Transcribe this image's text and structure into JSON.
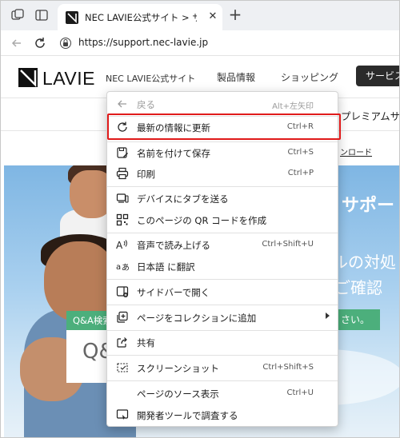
{
  "browser": {
    "tab": {
      "title": "NEC LAVIE公式サイト > サービス＆サポート",
      "close": "✕"
    },
    "new_tab": "+",
    "url": "https://support.nec-lavie.jp"
  },
  "site": {
    "logo": "LAVIE",
    "site_name": "NEC LAVIE公式サイト",
    "nav": [
      "製品情報",
      "ショッピング"
    ],
    "support_button": "サービス",
    "premium": "プレミアムサ",
    "download": "ンロード"
  },
  "hero": {
    "title": "サポート",
    "line1": "ルの対処",
    "line2": "をご確認",
    "qa_tab": "Q&A検索",
    "qa_text": "Q&",
    "green_button": "さい。"
  },
  "context_menu": {
    "items": [
      {
        "label": "戻る",
        "shortcut": "Alt+左矢印",
        "icon": "back-arrow-icon",
        "disabled": true
      },
      {
        "label": "最新の情報に更新",
        "shortcut": "Ctrl+R",
        "icon": "refresh-icon",
        "highlighted": true
      },
      {
        "label": "名前を付けて保存",
        "shortcut": "Ctrl+S",
        "icon": "save-as-icon"
      },
      {
        "label": "印刷",
        "shortcut": "Ctrl+P",
        "icon": "print-icon"
      },
      {
        "label": "デバイスにタブを送る",
        "shortcut": "",
        "icon": "send-tab-icon"
      },
      {
        "label": "このページの QR コードを作成",
        "shortcut": "",
        "icon": "qr-code-icon"
      },
      {
        "label": "音声で読み上げる",
        "shortcut": "Ctrl+Shift+U",
        "icon": "read-aloud-icon"
      },
      {
        "label": "日本語 に翻訳",
        "shortcut": "",
        "icon": "translate-icon"
      },
      {
        "label": "サイドバーで開く",
        "shortcut": "",
        "icon": "sidebar-icon"
      },
      {
        "label": "ページをコレクションに追加",
        "shortcut": "",
        "icon": "collections-icon",
        "submenu": true
      },
      {
        "label": "共有",
        "shortcut": "",
        "icon": "share-icon"
      },
      {
        "label": "スクリーンショット",
        "shortcut": "Ctrl+Shift+S",
        "icon": "screenshot-icon"
      },
      {
        "label": "ページのソース表示",
        "shortcut": "Ctrl+U",
        "icon": ""
      },
      {
        "label": "開発者ツールで調査する",
        "shortcut": "",
        "icon": "devtools-icon"
      }
    ],
    "highlight_color": "#e01a1a"
  },
  "colors": {
    "accent_green": "#4caf7c",
    "menu_highlight": "#e01a1a"
  }
}
